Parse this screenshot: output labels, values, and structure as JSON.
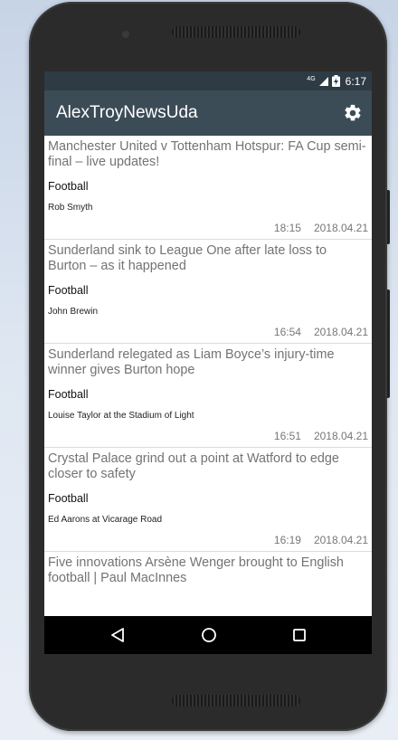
{
  "status": {
    "network": "4G",
    "time": "6:17"
  },
  "app": {
    "title": "AlexTroyNewsUda"
  },
  "articles": [
    {
      "title": "Manchester United v Tottenham Hotspur: FA Cup semi-final – live updates!",
      "category": "Football",
      "author": "Rob Smyth",
      "time": "18:15",
      "date": "2018.04.21"
    },
    {
      "title": "Sunderland sink to League One after late loss to Burton – as it happened",
      "category": "Football",
      "author": "John Brewin",
      "time": "16:54",
      "date": "2018.04.21"
    },
    {
      "title": "Sunderland relegated as Liam Boyce’s injury-time winner gives Burton hope",
      "category": "Football",
      "author": "Louise Taylor at the Stadium of Light",
      "time": "16:51",
      "date": "2018.04.21"
    },
    {
      "title": "Crystal Palace grind out a point at Watford to edge closer to safety",
      "category": "Football",
      "author": "Ed Aarons at Vicarage Road",
      "time": "16:19",
      "date": "2018.04.21"
    },
    {
      "title": "Five innovations Arsène Wenger brought to English football | Paul MacInnes"
    }
  ],
  "icons": {
    "settings": "gear-icon",
    "back": "back-triangle-icon",
    "home": "home-circle-icon",
    "recents": "recents-square-icon"
  }
}
